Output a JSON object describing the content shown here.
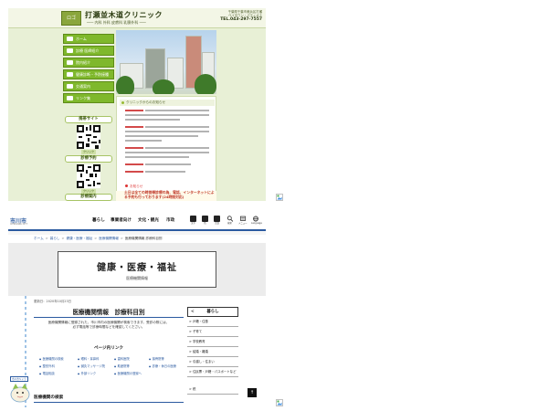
{
  "clinic": {
    "logo_text": "ロゴ",
    "title": "打瀬並木道クリニック",
    "subtitle": "─── 内科 外科 皮膚科 乳腺外科 ───",
    "contact_lines": [
      "千葉県千葉市美浜区打瀬",
      "ベイタウン・パティオス",
      "TEL.043-297-7557"
    ],
    "tel": "TEL.043-297-7557",
    "side_buttons": [
      {
        "label": "ホーム"
      },
      {
        "label": "診療 医師紹介"
      },
      {
        "label": "院内紹介"
      },
      {
        "label": "健康診断・予防接種"
      },
      {
        "label": "交通案内"
      },
      {
        "label": "リンク集"
      }
    ],
    "mobile_site_label": "携帯サイト",
    "reservation_label": "診療予約",
    "guide_label": "診療案内",
    "small_label_1": "クリック",
    "small_label_2": "クリック",
    "small_label_3": "HOME",
    "news_heading": "クリニックからのお知らせ",
    "news_footer": "お知らせ",
    "notice": "土日は全ての時間帯診療の為、電話、インターネットによる予約も行っております(24時間対応)"
  },
  "city": {
    "logo": "市川市",
    "logo_sub": "ICHIKAWA CITY",
    "nav": [
      "暮らし",
      "事業者向け",
      "文化・観光",
      "市政"
    ],
    "tools": [
      "文字",
      "色",
      "言語",
      "検索",
      "メニュー",
      "Language"
    ],
    "breadcrumb": [
      "ホーム",
      "暮らし",
      "健康・医療・福祉",
      "医療機関情報",
      "医療機関情報 診療科目別"
    ],
    "hero_title": "健康・医療・福祉",
    "hero_sub": "医療機関情報",
    "updated": "更新日：2020年10月23日",
    "main_title": "医療機関情報　診療科目別",
    "main_desc": "医療機関情報に登録された、市川市内の医療機関が検索できます。受診の際には、必ず電話等で診療時間などを確認してください。",
    "links_head": "ページ内リンク",
    "page_links": [
      "医療機関の検索",
      "眼科・耳鼻科",
      "歯科医院",
      "接骨院等",
      "整形外科",
      "鍼灸マッサージ院",
      "助産院等",
      "診療・休日の医療",
      "電話相談",
      "外部リンク",
      "医療機関の登録へ"
    ],
    "search_head": "医療機関の検索",
    "mascot_label": "市川市キャラ",
    "sidebar_head": "暮らし",
    "sidebar_items": [
      "戸籍・住基",
      "子育て",
      "学校教育",
      "結婚・離婚",
      "引越し・住まい",
      "住民票・戸籍・パスポートなど",
      "税"
    ],
    "to_top": "↑"
  },
  "colors": {
    "clinic_green": "#7fb82c",
    "clinic_bg": "#e8f0d6",
    "city_blue": "#2b5aa0",
    "notice_red": "#c0392b"
  }
}
